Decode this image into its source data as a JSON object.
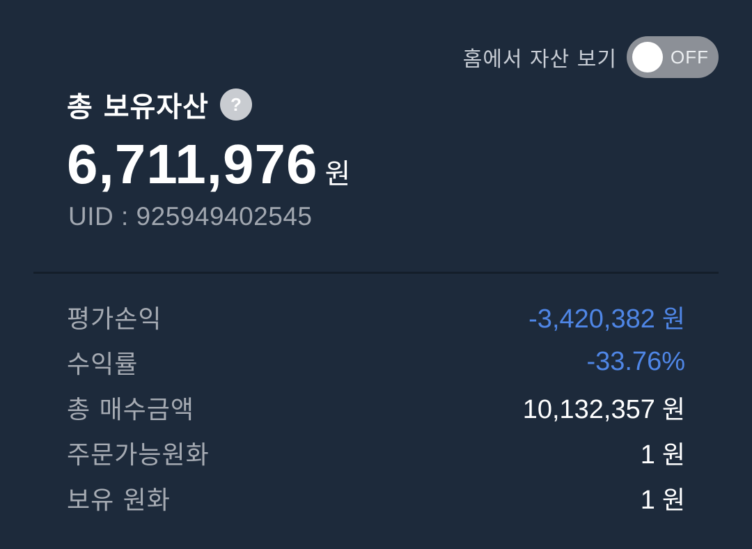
{
  "toggle": {
    "label": "홈에서 자산 보기",
    "state_text": "OFF",
    "on": false
  },
  "summary": {
    "title": "총 보유자산",
    "help_icon": "question-mark-icon",
    "total_amount": "6,711,976",
    "total_unit": "원",
    "uid_label": "UID : 925949402545"
  },
  "stats": {
    "rows": [
      {
        "label": "평가손익",
        "value": "-3,420,382",
        "unit": "원",
        "negative": true
      },
      {
        "label": "수익률",
        "value": "-33.76%",
        "unit": "",
        "negative": true
      },
      {
        "label": "총 매수금액",
        "value": "10,132,357",
        "unit": "원",
        "negative": false
      },
      {
        "label": "주문가능원화",
        "value": "1",
        "unit": "원",
        "negative": false
      },
      {
        "label": "보유 원화",
        "value": "1",
        "unit": "원",
        "negative": false
      }
    ]
  },
  "colors": {
    "background": "#1d2a3b",
    "negative": "#4f86e6",
    "toggle_off": "#8c9097"
  }
}
